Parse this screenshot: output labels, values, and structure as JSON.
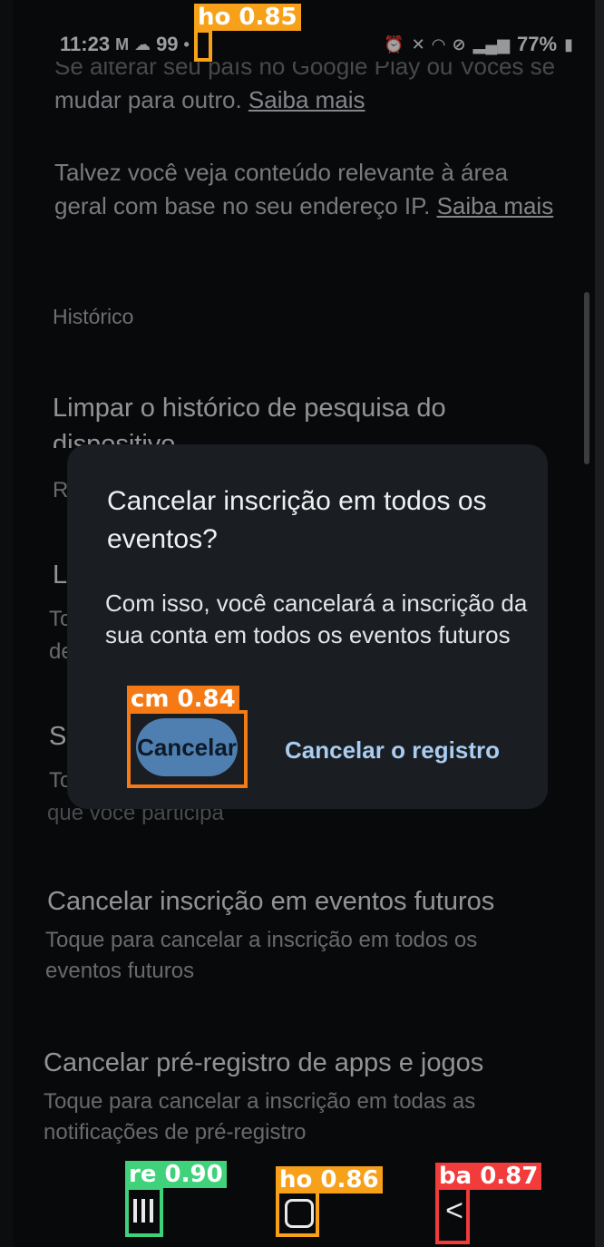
{
  "status_bar": {
    "time": "11:23",
    "left_icons": [
      "gmail-icon",
      "cloud-icon"
    ],
    "notification_count": "99",
    "battery": "77%",
    "right_icons": [
      "alarm-icon",
      "mute-icon",
      "wifi-icon",
      "dnd-icon",
      "volte-icon",
      "signal-icon",
      "battery-icon"
    ]
  },
  "settings": {
    "para1_line1": "Se alterar seu país no Google Play ou Vocês se",
    "para1_line2": "mudar para outro.",
    "para1_link": "Saiba mais",
    "para2_line1": "Talvez você veja conteúdo relevante à área",
    "para2_line2": "geral com base no seu endereço IP.",
    "para2_link": "Saiba mais",
    "section_label": "Histórico",
    "item1_title": "Limpar o histórico de pesquisa do",
    "item1_title2": "dispositivo",
    "item1_sub_partial": "Re",
    "item2_title_partial": "Li",
    "item2_sub_partial1": "To",
    "item2_sub_partial2": "de",
    "item3_title_partial": "S",
    "item3_sub_partial": "To",
    "item3_sub_line2": "que você participa",
    "item4_title": "Cancelar inscrição em eventos futuros",
    "item4_sub": "Toque para cancelar a inscrição em todos os eventos futuros",
    "item5_title": "Cancelar pré-registro de apps e jogos",
    "item5_sub": "Toque para cancelar a inscrição em todas as notificações de pré-registro"
  },
  "dialog": {
    "title": "Cancelar inscrição em todos os eventos?",
    "body": "Com isso, você cancelará a inscrição da sua conta em todos os eventos futuros",
    "cancel_button": "Cancelar",
    "unregister_button": "Cancelar o registro"
  },
  "navbar": {
    "recent_icon": "recent-apps-icon",
    "home_icon": "home-icon",
    "back_icon": "back-icon"
  },
  "detections": [
    {
      "label": "ho 0.85",
      "color": "#f7a11a"
    },
    {
      "label": "cm 0.84",
      "color": "#f57a15"
    },
    {
      "label": "re 0.90",
      "color": "#3fd27a"
    },
    {
      "label": "ho 0.86",
      "color": "#f7a11a"
    },
    {
      "label": "ba 0.87",
      "color": "#f23b3b"
    }
  ]
}
